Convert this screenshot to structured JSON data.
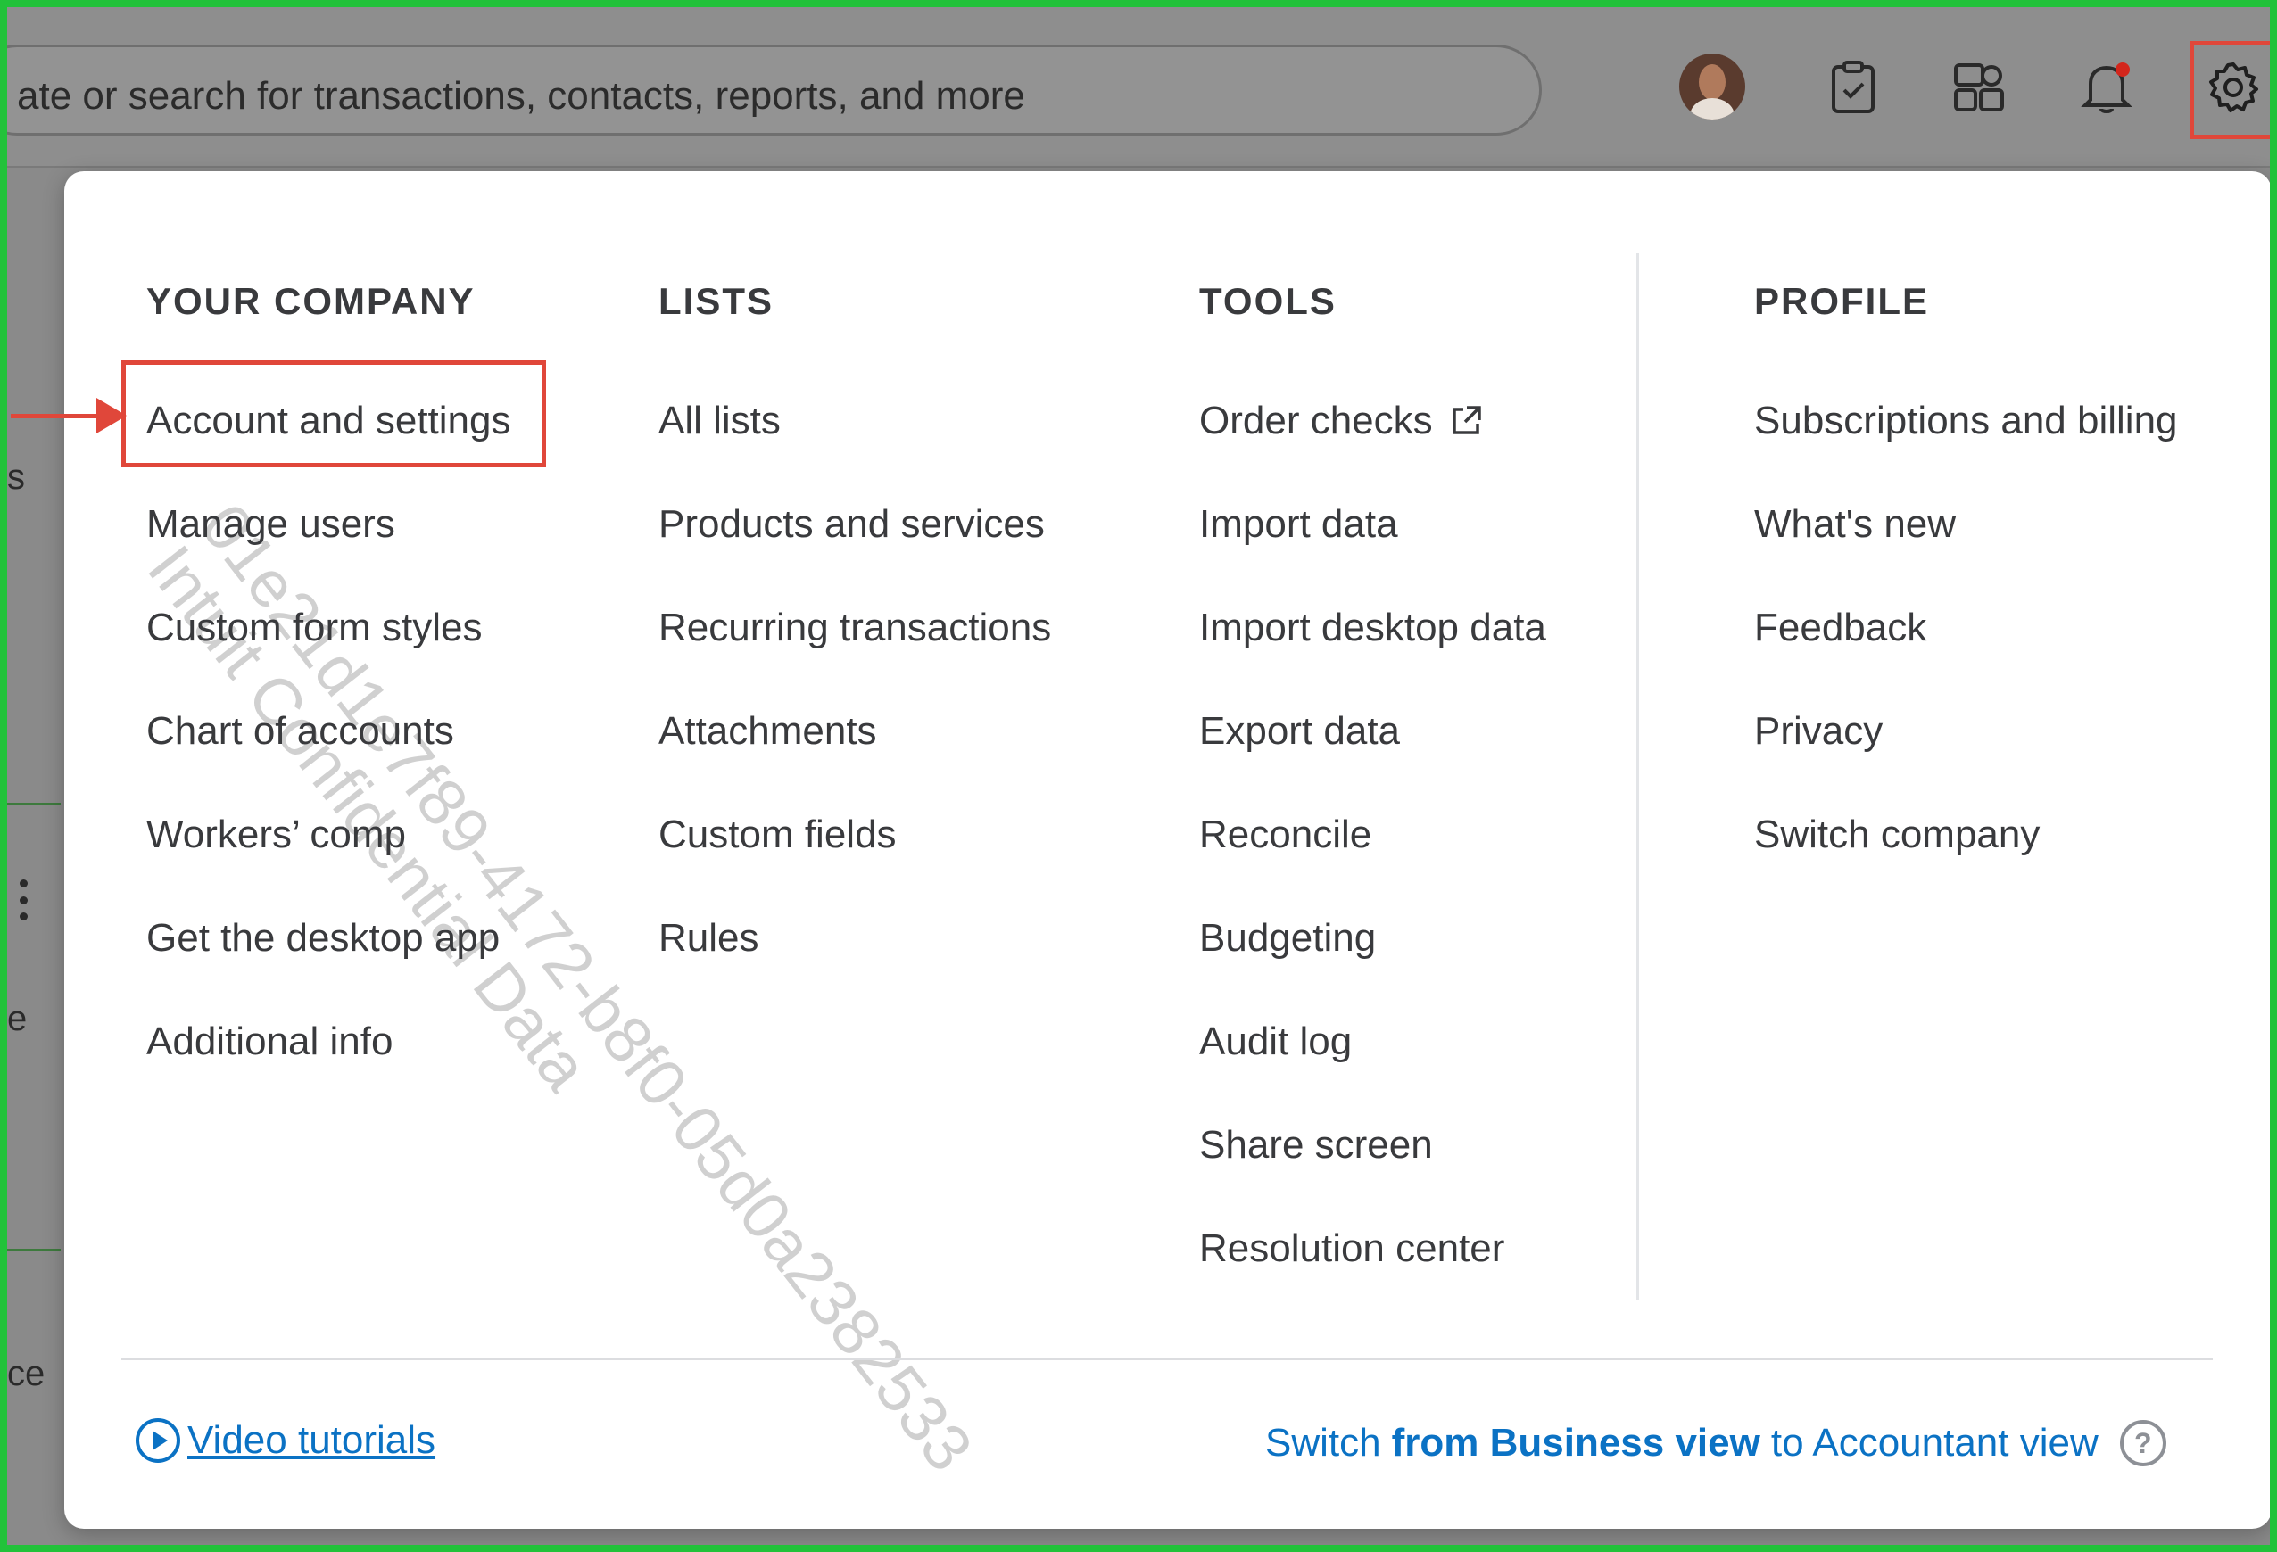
{
  "topbar": {
    "search_placeholder": "ate or search for transactions, contacts, reports, and more",
    "icons": [
      "avatar",
      "task-icon",
      "apps-icon",
      "notification-icon",
      "gear-icon"
    ]
  },
  "background_fragments": {
    "frag1": "s",
    "frag2": "e",
    "frag3": "ce"
  },
  "menu": {
    "columns": [
      {
        "heading": "YOUR COMPANY",
        "items": [
          "Account and settings",
          "Manage users",
          "Custom form styles",
          "Chart of accounts",
          "Workers’ comp",
          "Get the desktop app",
          "Additional info"
        ]
      },
      {
        "heading": "LISTS",
        "items": [
          "All lists",
          "Products and services",
          "Recurring transactions",
          "Attachments",
          "Custom fields",
          "Rules"
        ]
      },
      {
        "heading": "TOOLS",
        "items": [
          "Order checks",
          "Import data",
          "Import desktop data",
          "Export data",
          "Reconcile",
          "Budgeting",
          "Audit log",
          "Share screen",
          "Resolution center"
        ]
      },
      {
        "heading": "PROFILE",
        "items": [
          "Subscriptions and billing",
          "What's new",
          "Feedback",
          "Privacy",
          "Switch company"
        ]
      }
    ],
    "footer": {
      "video_tutorials": "Video tutorials",
      "switch_prefix": "Switch",
      "switch_bold": "from Business view",
      "switch_suffix": "to Accountant view",
      "help": "?"
    }
  },
  "watermark": {
    "line1": "01e21d1e7f89-4172-b8f0-05d0a2382533",
    "line2": "Intuit Confidential Data"
  },
  "colors": {
    "highlight": "#e0473a",
    "link": "#0b72c4",
    "frame": "#22c23a",
    "text": "#393a3d"
  }
}
